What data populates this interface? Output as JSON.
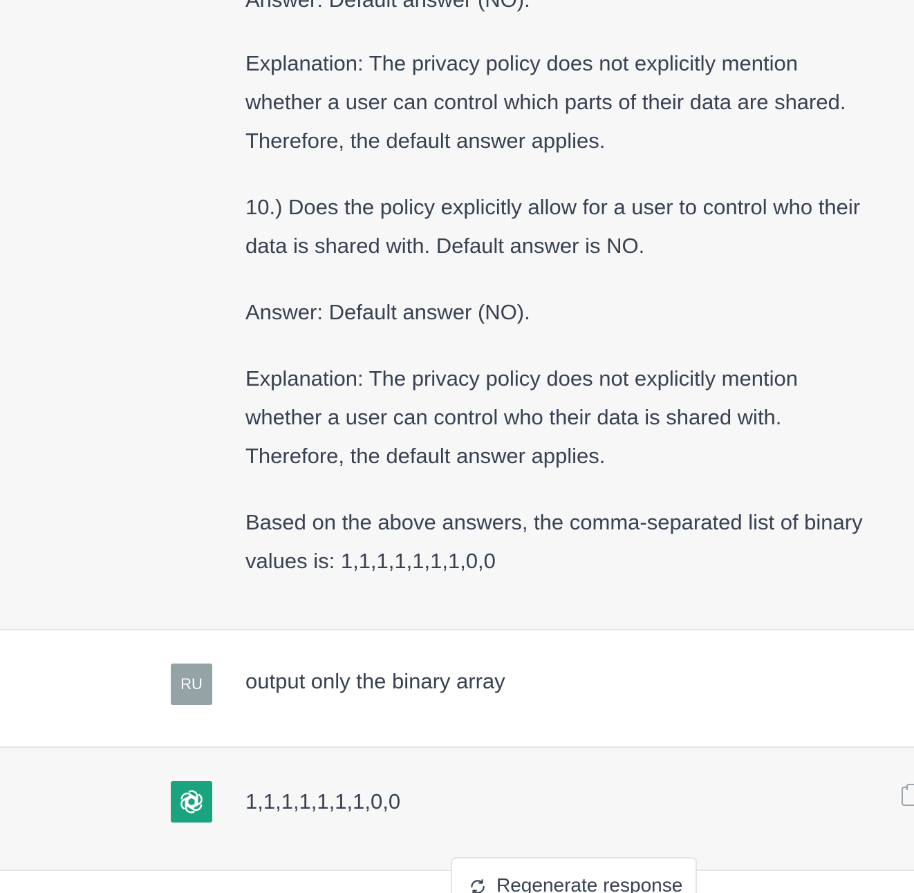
{
  "conversation": {
    "previous_answer_tail": "Answer: Default answer (NO).",
    "explanation_9": [
      "Explanation: The privacy policy does not explicitly mention",
      "whether a user can control which parts of their data are shared.",
      "Therefore, the default answer applies."
    ],
    "question_10": [
      "10.) Does the policy explicitly allow for a user to control who their",
      "data is shared with. Default answer is NO."
    ],
    "answer_10": "Answer: Default answer (NO).",
    "explanation_10": [
      "Explanation: The privacy policy does not explicitly mention",
      "whether a user can control who their data is shared with.",
      "Therefore, the default answer applies."
    ],
    "summary": [
      "Based on the above answers, the comma-separated list of binary",
      "values is: 1,1,1,1,1,1,1,0,0"
    ],
    "user_message": {
      "avatar_initials": "RU",
      "text": "output only the binary array"
    },
    "assistant_reply": {
      "avatar_icon": "openai-logo-icon",
      "text": "1,1,1,1,1,1,1,0,0"
    }
  },
  "actions": {
    "regenerate_label": "Regenerate response",
    "regenerate_icon": "refresh-icon",
    "copy_icon": "clipboard-icon"
  },
  "colors": {
    "assistant_bg": "#f7f7f8",
    "user_bg": "#ffffff",
    "bot_avatar": "#19a37f",
    "user_avatar": "#94a3a6",
    "text": "#374151"
  }
}
